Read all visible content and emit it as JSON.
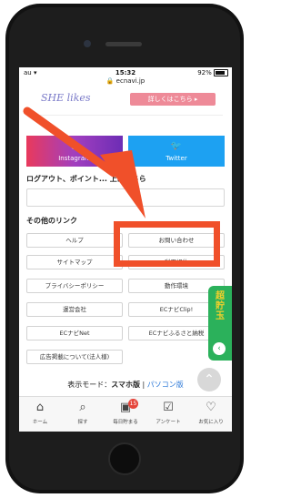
{
  "status_bar": {
    "carrier": "au",
    "time": "15:32",
    "battery": "92%"
  },
  "browser": {
    "url": "ecnavi.jp"
  },
  "banner": {
    "logo": "SHE likes",
    "cta": "詳しくはこちら ▸"
  },
  "sns": {
    "instagram": "Instagram",
    "twitter": "Twitter"
  },
  "logout_text": "ログアウト、ポイント... 上はこちら",
  "other_links": {
    "heading": "その他のリンク",
    "items": [
      "ヘルプ",
      "お問い合わせ",
      "サイトマップ",
      "利用規約",
      "プライバシーポリシー",
      "動作環境",
      "運営会社",
      "ECナビClip!",
      "ECナビNet",
      "ECナビふるさと納税",
      "広告掲載について(法人様)"
    ]
  },
  "display_mode": {
    "label": "表示モード：",
    "current": "スマホ版",
    "separator": " | ",
    "other": "パソコン版"
  },
  "side_banner": {
    "text": "超貯玉"
  },
  "tabbar": {
    "items": [
      {
        "label": "ホーム",
        "icon": "home-icon"
      },
      {
        "label": "探す",
        "icon": "search-icon"
      },
      {
        "label": "毎日貯まる",
        "icon": "gift-icon",
        "badge": "15"
      },
      {
        "label": "アンケート",
        "icon": "clipboard-icon"
      },
      {
        "label": "お気に入り",
        "icon": "heart-icon"
      }
    ]
  },
  "colors": {
    "accent": "#f0502a",
    "twitter": "#1da1f2",
    "link": "#2574d6",
    "side_green": "#2bb15b"
  }
}
